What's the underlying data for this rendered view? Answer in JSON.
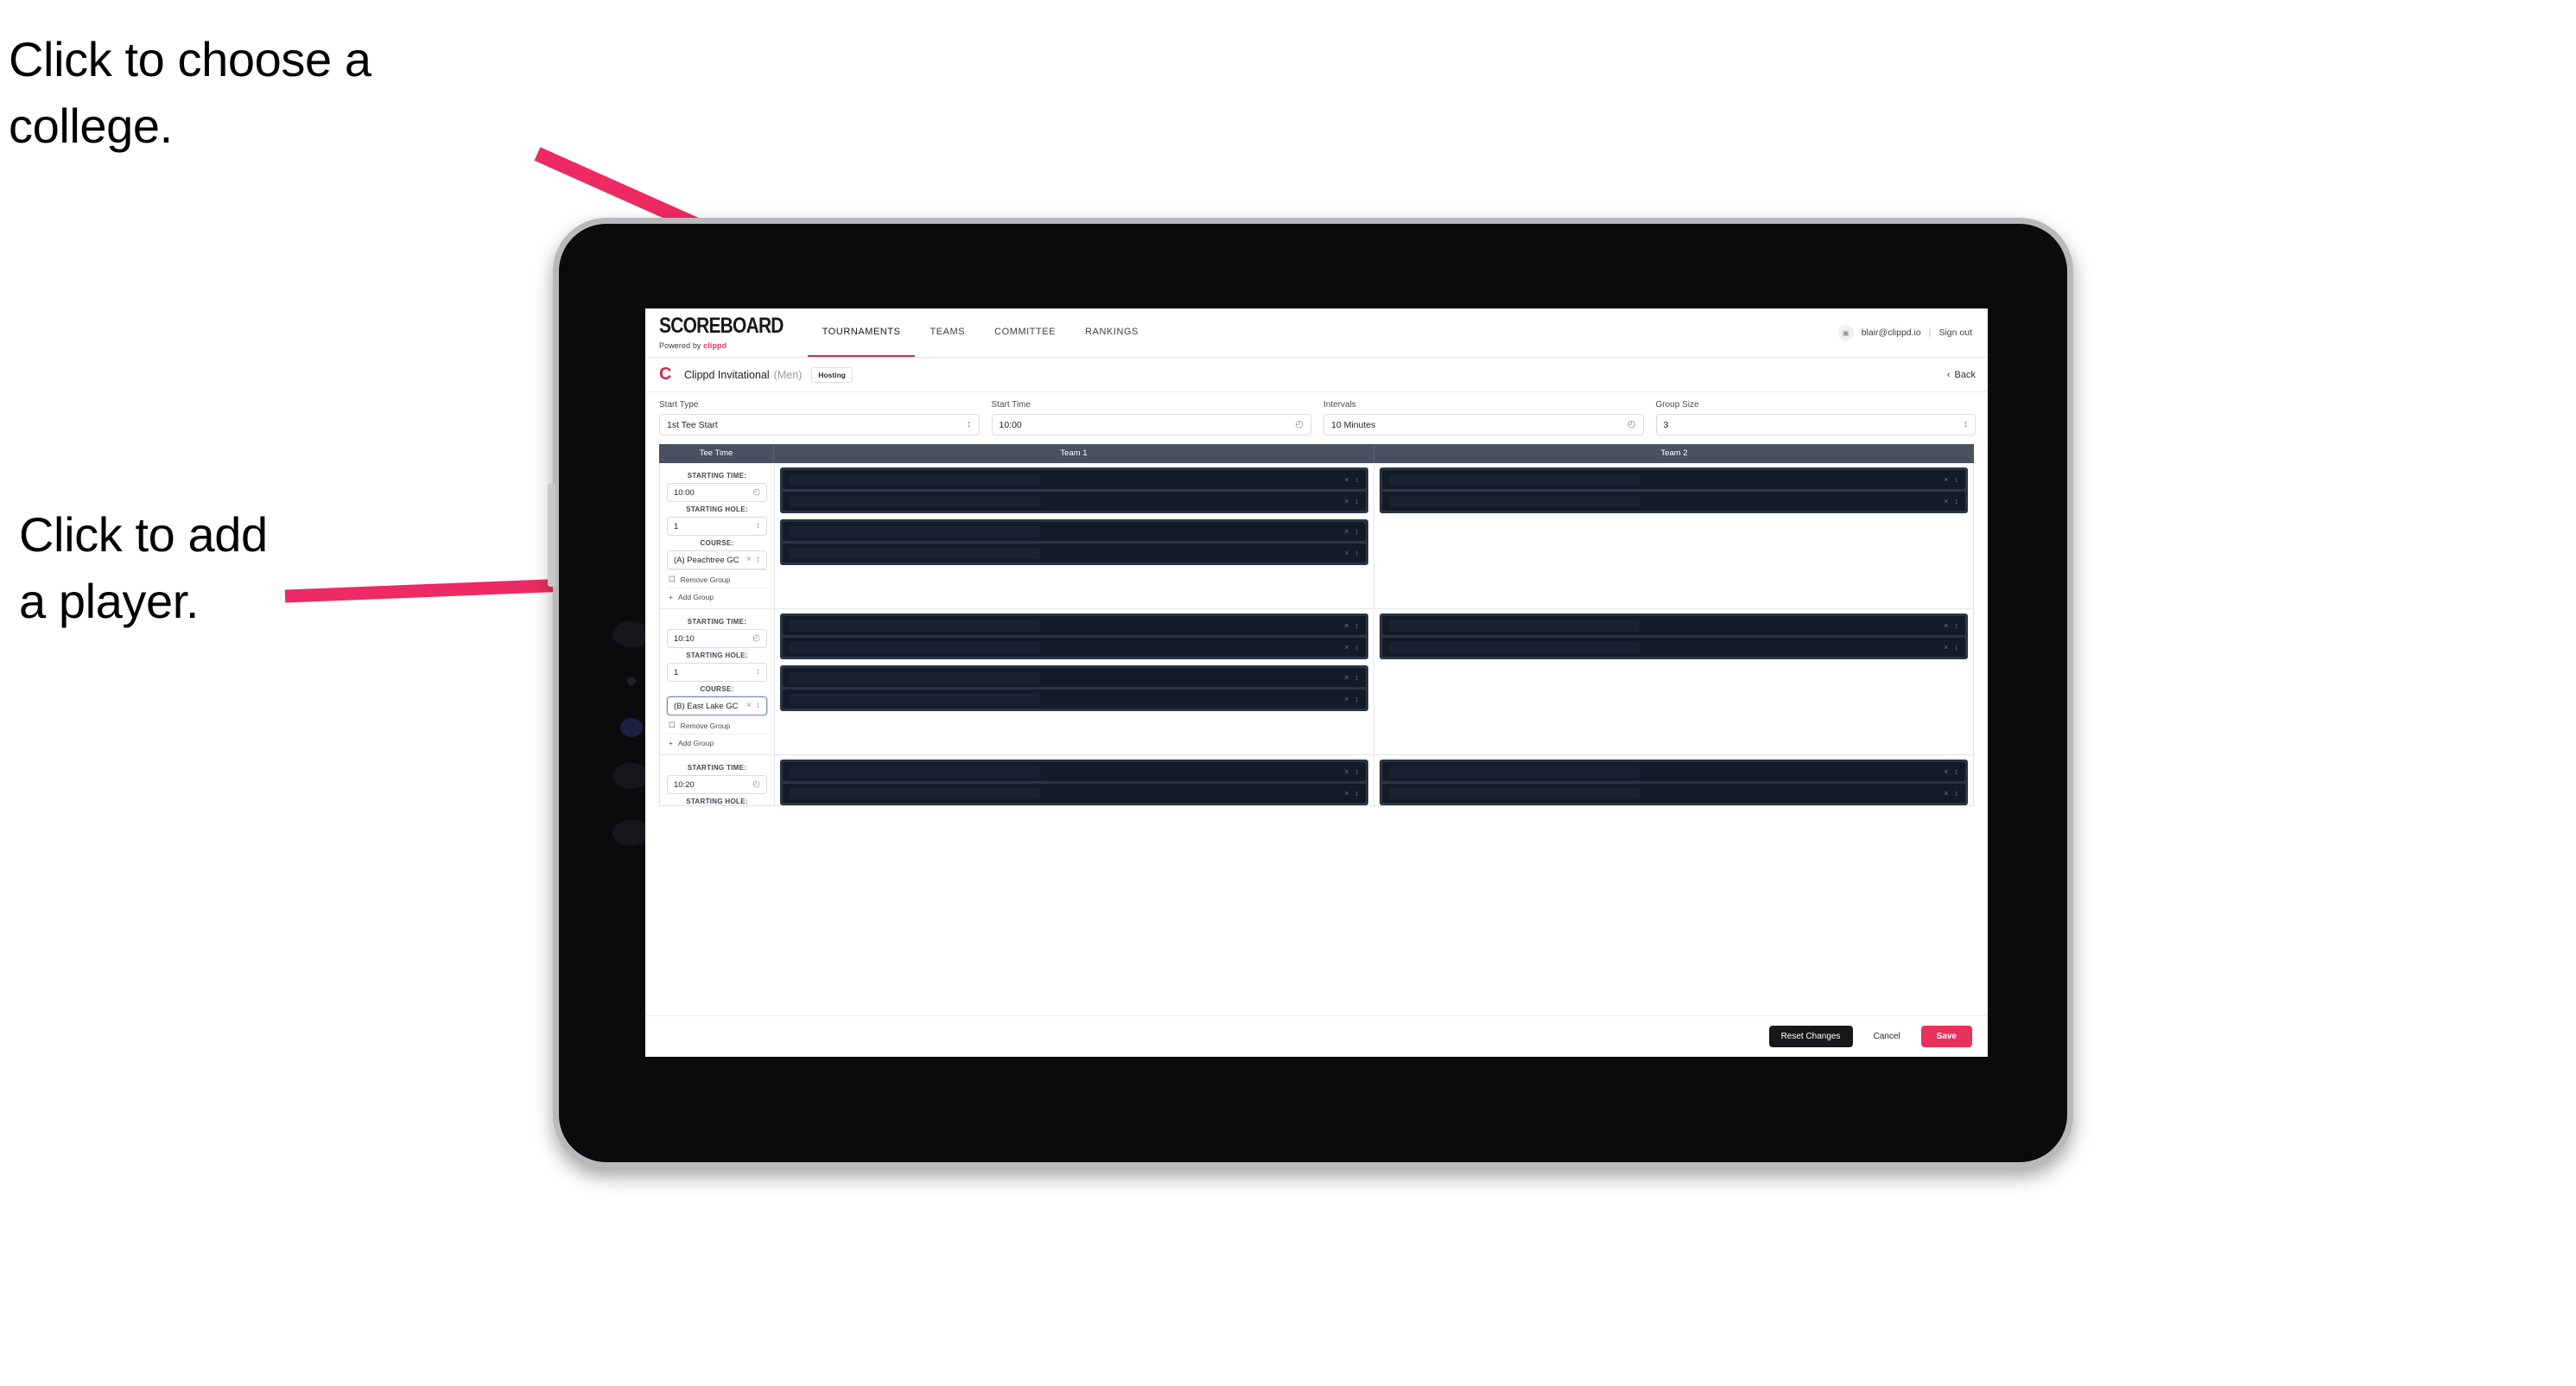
{
  "annotations": {
    "college": "Click to choose a\ncollege.",
    "player": "Click to add\na player.",
    "arrow_color": "#ed2a63"
  },
  "topnav": {
    "brand_word": "SCOREBOARD",
    "brand_sub_prefix": "Powered by ",
    "brand_sub_name": "clippd",
    "tabs": [
      {
        "label": "TOURNAMENTS",
        "active": true
      },
      {
        "label": "TEAMS",
        "active": false
      },
      {
        "label": "COMMITTEE",
        "active": false
      },
      {
        "label": "RANKINGS",
        "active": false
      }
    ],
    "avatar_glyph": "▣",
    "user_email": "blair@clippd.io",
    "separator": "|",
    "sign_out": "Sign out"
  },
  "tournament_bar": {
    "logo_letter": "C",
    "name": "Clippd Invitational",
    "gender": "(Men)",
    "badge": "Hosting",
    "back_chevron": "‹",
    "back_label": "Back"
  },
  "settings": {
    "fields": [
      {
        "label": "Start Type",
        "value": "1st Tee Start",
        "icon": "↕",
        "icon_name": "stepper-icon"
      },
      {
        "label": "Start Time",
        "value": "10:00",
        "icon": "◴",
        "icon_name": "clock-icon"
      },
      {
        "label": "Intervals",
        "value": "10 Minutes",
        "icon": "◴",
        "icon_name": "clock-icon"
      },
      {
        "label": "Group Size",
        "value": "3",
        "icon": "↕",
        "icon_name": "stepper-icon"
      }
    ]
  },
  "table": {
    "headers": {
      "tee_time": "Tee Time",
      "team1": "Team 1",
      "team2": "Team 2"
    },
    "labels": {
      "starting_time": "STARTING TIME:",
      "starting_hole": "STARTING HOLE:",
      "course": "COURSE:",
      "remove_group": "Remove Group",
      "add_group": "Add Group",
      "trash_icon": "☐",
      "plus_icon": "+",
      "clear_icon": "×",
      "stepper_icon": "↕",
      "clock_icon": "◴"
    },
    "rows": [
      {
        "starting_time": "10:00",
        "starting_hole": "1",
        "course": "(A) Peachtree GC",
        "course_focused": false,
        "team1_cards": [
          {
            "slots": 2
          },
          {
            "slots": 2
          }
        ],
        "team2_cards": [
          {
            "slots": 2
          }
        ]
      },
      {
        "starting_time": "10:10",
        "starting_hole": "1",
        "course": "(B) East Lake GC",
        "course_focused": true,
        "team1_cards": [
          {
            "slots": 2
          },
          {
            "slots": 2
          }
        ],
        "team2_cards": [
          {
            "slots": 2
          }
        ]
      },
      {
        "starting_time": "10:20",
        "starting_hole": "",
        "course": "",
        "course_focused": false,
        "team1_cards": [
          {
            "slots": 2
          }
        ],
        "team2_cards": [
          {
            "slots": 2
          }
        ]
      }
    ]
  },
  "footer": {
    "reset": "Reset Changes",
    "cancel": "Cancel",
    "save": "Save"
  },
  "colors": {
    "accent_pink": "#e8315c",
    "table_header": "#49505f",
    "dark_card": "#2a3444",
    "dark_slot": "#141b28"
  }
}
